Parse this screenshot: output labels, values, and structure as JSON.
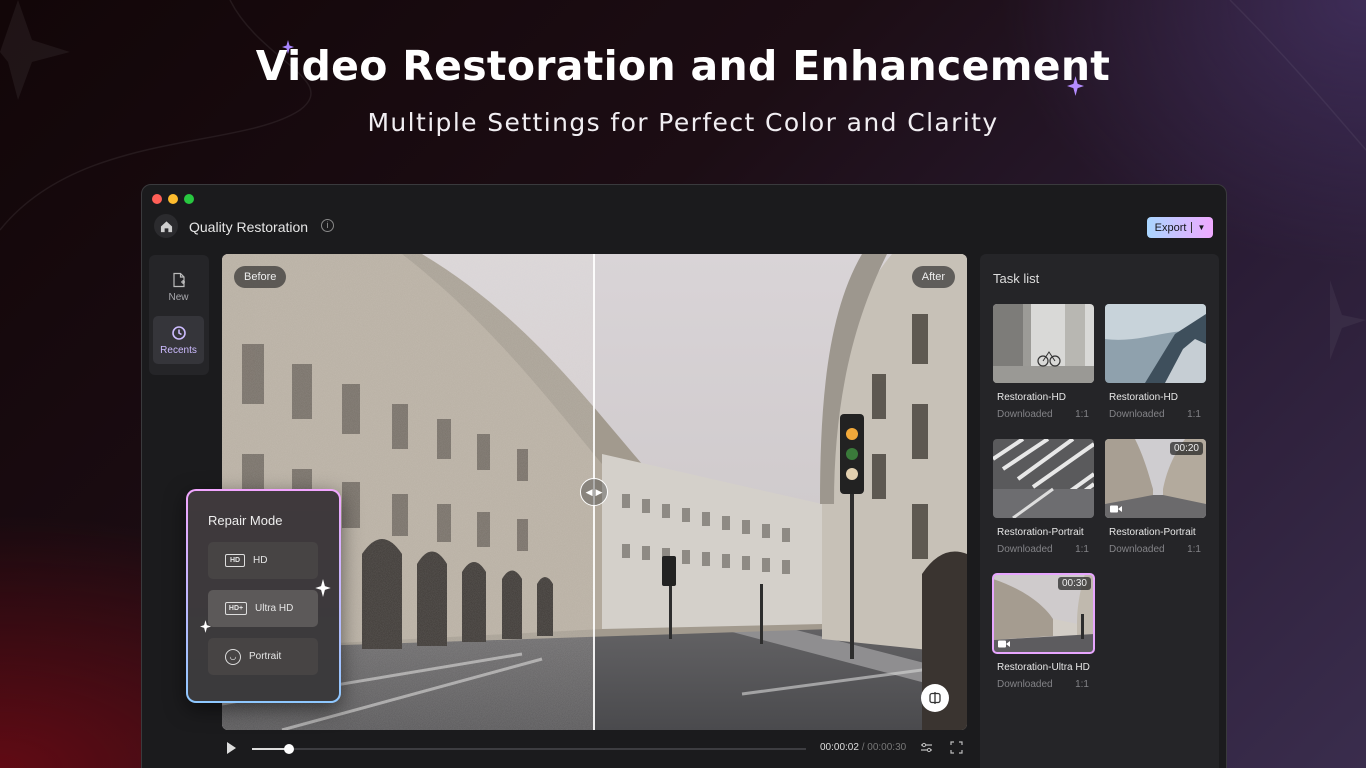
{
  "hero": {
    "title": "Video Restoration and Enhancement",
    "subtitle": "Multiple Settings for Perfect Color and Clarity"
  },
  "window": {
    "title": "Quality Restoration",
    "export_label": "Export",
    "traffic_lights": [
      "#ff5f57",
      "#febc2e",
      "#28c840"
    ]
  },
  "sidebar": {
    "items": [
      {
        "label": "New",
        "icon": "new-file-icon",
        "active": false
      },
      {
        "label": "Recents",
        "icon": "recents-icon",
        "active": true
      }
    ]
  },
  "viewer": {
    "before_label": "Before",
    "after_label": "After"
  },
  "playback": {
    "current_time": "00:00:02",
    "separator": "/",
    "duration": "00:00:30",
    "progress": 0.066
  },
  "repair_mode": {
    "title": "Repair Mode",
    "options": [
      {
        "label": "HD",
        "icon": "hd-icon",
        "active": false
      },
      {
        "label": "Ultra HD",
        "icon": "hd-plus-icon",
        "active": true
      },
      {
        "label": "Portrait",
        "icon": "portrait-face-icon",
        "active": false
      }
    ]
  },
  "task_list": {
    "title": "Task list",
    "items": [
      {
        "name": "Restoration-HD",
        "status": "Downloaded",
        "ratio": "1:1",
        "duration": "",
        "video": false,
        "selected": false
      },
      {
        "name": "Restoration-HD",
        "status": "Downloaded",
        "ratio": "1:1",
        "duration": "",
        "video": false,
        "selected": false
      },
      {
        "name": "Restoration-Portrait",
        "status": "Downloaded",
        "ratio": "1:1",
        "duration": "",
        "video": false,
        "selected": false
      },
      {
        "name": "Restoration-Portrait",
        "status": "Downloaded",
        "ratio": "1:1",
        "duration": "00:20",
        "video": true,
        "selected": false
      },
      {
        "name": "Restoration-Ultra HD",
        "status": "Downloaded",
        "ratio": "1:1",
        "duration": "00:30",
        "video": true,
        "selected": true
      }
    ]
  },
  "colors": {
    "accent_pink": "#f3a6ff",
    "accent_blue": "#8ec8ff",
    "panel": "#252528"
  }
}
